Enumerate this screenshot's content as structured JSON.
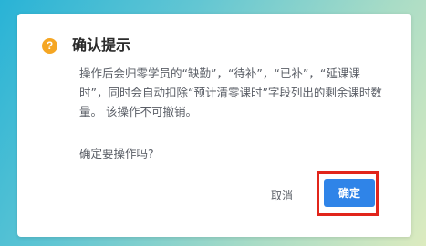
{
  "dialog": {
    "icon": "warning-question-icon",
    "icon_glyph": "?",
    "title": "确认提示",
    "message": "操作后会归零学员的“缺勤”，“待补”，“已补”，“延课课时”，同时会自动扣除“预计清零课时”字段列出的剩余课时数量。 该操作不可撤销。",
    "question": "确定要操作吗?",
    "cancel_label": "取消",
    "confirm_label": "确定"
  },
  "colors": {
    "warning": "#f5a623",
    "primary": "#2f84e8",
    "highlight": "#e1251b"
  }
}
